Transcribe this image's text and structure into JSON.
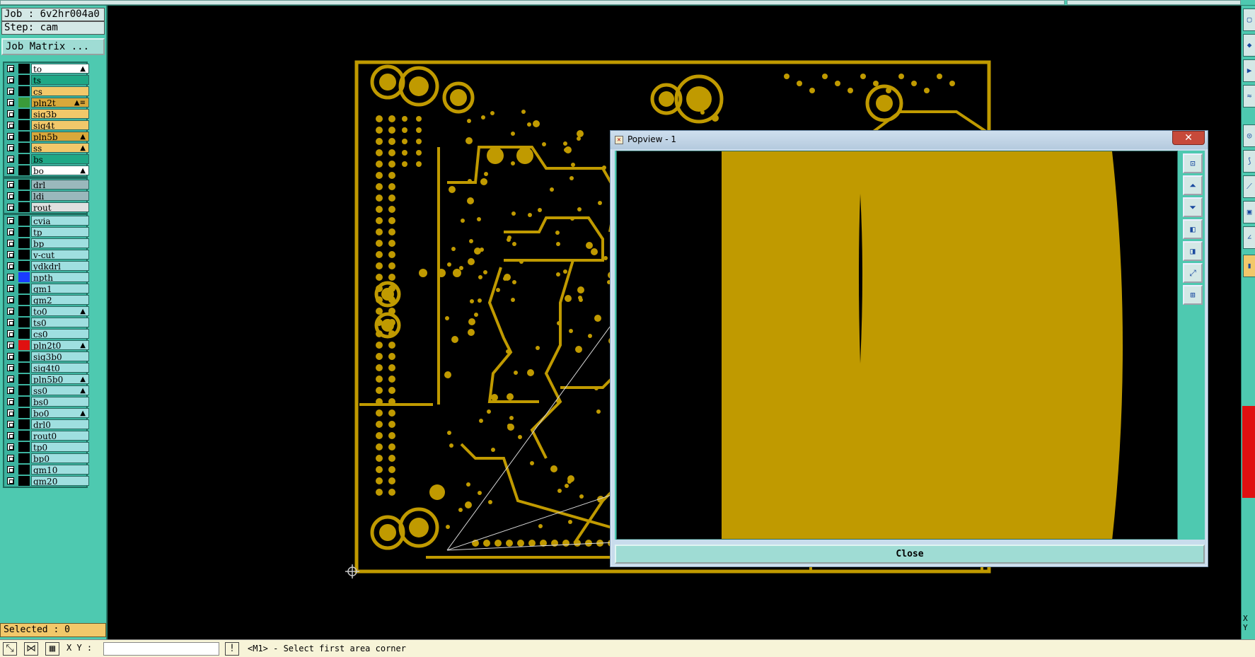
{
  "job_label": "Job : 6v2hr004a0",
  "step_label": "Step: cam",
  "job_matrix_button": "Job Matrix ...",
  "layer_groups": [
    [
      {
        "name": "to",
        "color": "#ffffff",
        "swatch": "#000000",
        "mark": "▲"
      },
      {
        "name": "ts",
        "color": "#1fa886",
        "swatch": "#000000",
        "mark": ""
      },
      {
        "name": "cs",
        "color": "#f2c86a",
        "swatch": "#000000",
        "mark": ""
      },
      {
        "name": "pln2t",
        "color": "#d9a83a",
        "swatch": "#3a9a3a",
        "mark": "▲≡"
      },
      {
        "name": "sig3b",
        "color": "#f2c86a",
        "swatch": "#000000",
        "mark": ""
      },
      {
        "name": "sig4t",
        "color": "#f2c86a",
        "swatch": "#000000",
        "mark": ""
      },
      {
        "name": "pln5b",
        "color": "#d9a83a",
        "swatch": "#000000",
        "mark": "▲"
      },
      {
        "name": "ss",
        "color": "#f2c86a",
        "swatch": "#000000",
        "mark": "▲"
      },
      {
        "name": "bs",
        "color": "#1fa886",
        "swatch": "#000000",
        "mark": ""
      },
      {
        "name": "bo",
        "color": "#ffffff",
        "swatch": "#000000",
        "mark": "▲"
      }
    ],
    [
      {
        "name": "drl",
        "color": "#9ab8bc",
        "swatch": "#000000",
        "mark": ""
      },
      {
        "name": "ldi",
        "color": "#9ab8bc",
        "swatch": "#000000",
        "mark": ""
      },
      {
        "name": "rout",
        "color": "#e0e0e0",
        "swatch": "#000000",
        "mark": ""
      }
    ],
    [
      {
        "name": "cvia",
        "color": "#9fdfe0",
        "swatch": "#000000",
        "mark": ""
      },
      {
        "name": "tp",
        "color": "#9fdfe0",
        "swatch": "#000000",
        "mark": ""
      },
      {
        "name": "bp",
        "color": "#9fdfe0",
        "swatch": "#000000",
        "mark": ""
      },
      {
        "name": "v-cut",
        "color": "#9fdfe0",
        "swatch": "#000000",
        "mark": ""
      },
      {
        "name": "ydkdrl",
        "color": "#9fdfe0",
        "swatch": "#000000",
        "mark": ""
      },
      {
        "name": "npth",
        "color": "#9fdfe0",
        "swatch": "#1a3cff",
        "mark": ""
      },
      {
        "name": "gm1",
        "color": "#9fdfe0",
        "swatch": "#000000",
        "mark": ""
      },
      {
        "name": "gm2",
        "color": "#9fdfe0",
        "swatch": "#000000",
        "mark": ""
      },
      {
        "name": "to0",
        "color": "#9fdfe0",
        "swatch": "#000000",
        "mark": "▲"
      },
      {
        "name": "ts0",
        "color": "#9fdfe0",
        "swatch": "#000000",
        "mark": ""
      },
      {
        "name": "cs0",
        "color": "#9fdfe0",
        "swatch": "#000000",
        "mark": ""
      },
      {
        "name": "pln2t0",
        "color": "#9fdfe0",
        "swatch": "#e01010",
        "mark": "▲"
      },
      {
        "name": "sig3b0",
        "color": "#9fdfe0",
        "swatch": "#000000",
        "mark": ""
      },
      {
        "name": "sig4t0",
        "color": "#9fdfe0",
        "swatch": "#000000",
        "mark": ""
      },
      {
        "name": "pln5b0",
        "color": "#9fdfe0",
        "swatch": "#000000",
        "mark": "▲"
      },
      {
        "name": "ss0",
        "color": "#9fdfe0",
        "swatch": "#000000",
        "mark": "▲"
      },
      {
        "name": "bs0",
        "color": "#9fdfe0",
        "swatch": "#000000",
        "mark": ""
      },
      {
        "name": "bo0",
        "color": "#9fdfe0",
        "swatch": "#000000",
        "mark": "▲"
      },
      {
        "name": "drl0",
        "color": "#9fdfe0",
        "swatch": "#000000",
        "mark": ""
      },
      {
        "name": "rout0",
        "color": "#9fdfe0",
        "swatch": "#000000",
        "mark": ""
      },
      {
        "name": "tp0",
        "color": "#9fdfe0",
        "swatch": "#000000",
        "mark": ""
      },
      {
        "name": "bp0",
        "color": "#9fdfe0",
        "swatch": "#000000",
        "mark": ""
      },
      {
        "name": "gm10",
        "color": "#9fdfe0",
        "swatch": "#000000",
        "mark": ""
      },
      {
        "name": "gm20",
        "color": "#9fdfe0",
        "swatch": "#000000",
        "mark": ""
      }
    ]
  ],
  "selected_label": "Selected : 0",
  "xy_label": "X Y :",
  "xy_value": "",
  "prompt_text": "<M1> - Select first area corner",
  "popview": {
    "title": "Popview - 1",
    "close_label": "Close",
    "close_x": "✕",
    "tools": [
      "zoom-home-icon",
      "pan-up-icon",
      "pan-down-icon",
      "pan-left-icon",
      "pan-right-icon",
      "zoom-fit-icon",
      "zoom-area-icon"
    ]
  },
  "right_strip_xy": "X\nY",
  "colors": {
    "board_gold": "#c09a00",
    "panel_teal": "#4ec9b0"
  }
}
